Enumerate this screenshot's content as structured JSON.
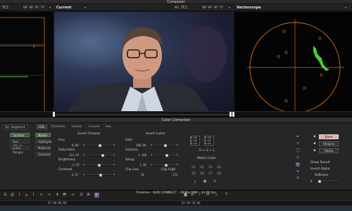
{
  "window": {
    "title": "Composer"
  },
  "monitors": {
    "left": {
      "timecode_label": "TC1",
      "timecode": "00:00:46:19"
    },
    "center": {
      "label": "Current",
      "timecode_label": "A1",
      "timecode_label2": "TC1",
      "timecode": "00:00:46:19"
    },
    "right": {
      "label": "Vectorscope"
    }
  },
  "color_correction": {
    "title": "Color Correction",
    "segment_select": "Src Segment",
    "tabs": [
      "HSL",
      "Channels",
      "Levels",
      "Curves",
      "Sec"
    ],
    "active_tab": "HSL",
    "side_buttons": [
      "Controls",
      "Hue Offsets",
      "Luma Ranges"
    ],
    "range_buttons": [
      "Master",
      "Highlights",
      "Midtones",
      "Shadows"
    ],
    "chroma": {
      "title": "Invert Chroma",
      "controls": [
        {
          "label": "Hue",
          "value": "0.00"
        },
        {
          "label": "Saturation",
          "value": "114.07"
        },
        {
          "label": "Brightness",
          "value": "-4.67"
        },
        {
          "label": "Contrast",
          "value": "6.67"
        }
      ]
    },
    "luma": {
      "title": "Invert Luma",
      "controls": [
        {
          "label": "Gain",
          "value": "100.00"
        },
        {
          "label": "Gamma",
          "value": "1.188"
        },
        {
          "label": "Setup",
          "value": "3.40"
        }
      ],
      "clip_low_label": "Clip Low",
      "clip_low_value": "16",
      "clip_high_label": "Clip High",
      "clip_high_value": "235"
    },
    "match": {
      "rgb_top": [
        "R:16",
        "G:16",
        "B:16"
      ],
      "rgb_bottom": [
        "R:16",
        "G:16",
        "B:16"
      ],
      "mode": "H + S + L",
      "title": "Match Color",
      "grid": [
        "C1",
        "C2",
        "C3",
        "C4",
        "C5",
        "C6",
        "C7",
        "C8"
      ]
    },
    "right_buttons": {
      "base": "Base",
      "shapes": "Shapes",
      "alpha": "Alpha",
      "show_result": "Show Result",
      "invert_alpha": "Invert Alpha",
      "softness_label": "Softness",
      "softness_value": "0"
    }
  },
  "timeline": {
    "title": "Timeline - AVID CONNECT - 1920x1080 - 24.00 fps",
    "ruler_left": "01:00:00:00",
    "ruler_right": "01:00:30:00"
  },
  "colors": {
    "accent_green": "#4dcc3a",
    "waveform_orange": "#d06a1e"
  }
}
